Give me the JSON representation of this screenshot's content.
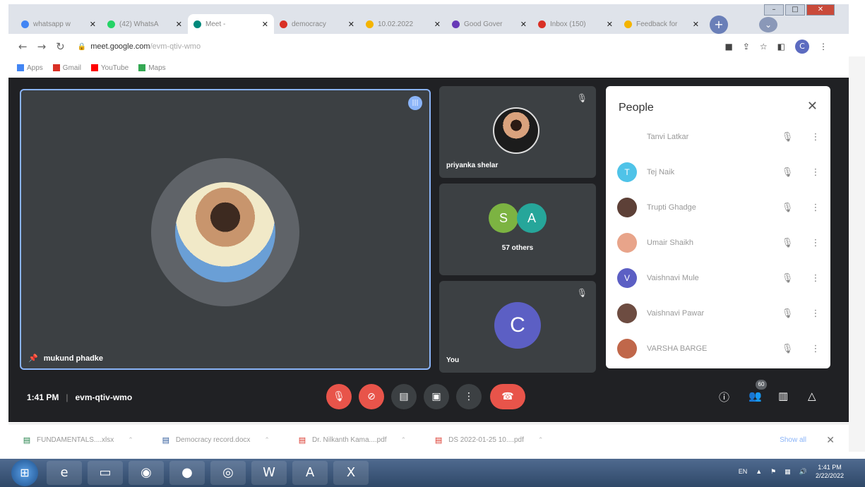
{
  "window": {
    "minimize": "–",
    "maximize": "□",
    "close": "✕"
  },
  "tabs": [
    {
      "label": "whatsapp w",
      "icon": "google-icon",
      "color": "#4285f4",
      "active": false
    },
    {
      "label": "(42) WhatsA",
      "icon": "whatsapp-icon",
      "color": "#25d366",
      "active": false
    },
    {
      "label": "Meet -",
      "icon": "meet-icon",
      "color": "#00897b",
      "active": true
    },
    {
      "label": "democracy",
      "icon": "gmail-icon",
      "color": "#d93025",
      "active": false
    },
    {
      "label": "10.02.2022",
      "icon": "drive-icon",
      "color": "#f4b400",
      "active": false
    },
    {
      "label": "Good Gover",
      "icon": "forms-icon",
      "color": "#673ab7",
      "active": false
    },
    {
      "label": "Inbox (150)",
      "icon": "gmail-icon",
      "color": "#d93025",
      "active": false
    },
    {
      "label": "Feedback for",
      "icon": "drive-icon",
      "color": "#f4b400",
      "active": false
    }
  ],
  "url": {
    "host": "meet.google.com",
    "path": "/evm-qtiv-wmo"
  },
  "profile_initial": "C",
  "bookmarks": [
    {
      "label": "Apps",
      "color": "#4285f4"
    },
    {
      "label": "Gmail",
      "color": "#d93025"
    },
    {
      "label": "YouTube",
      "color": "#ff0000"
    },
    {
      "label": "Maps",
      "color": "#34a853"
    }
  ],
  "main_tile": {
    "name": "mukund phadke"
  },
  "side_tiles": {
    "priyanka": {
      "name": "priyanka shelar"
    },
    "others": {
      "label": "57 others",
      "bubbles": [
        {
          "letter": "S",
          "color": "#7cb342"
        },
        {
          "letter": "A",
          "color": "#26a69a"
        }
      ]
    },
    "you": {
      "name": "You",
      "initial": "C"
    }
  },
  "people_panel": {
    "title": "People",
    "participants": [
      {
        "name": "Tanvi Latkar",
        "initial": "",
        "color": "#ffffff"
      },
      {
        "name": "Tej Naik",
        "initial": "T",
        "color": "#4fc3e8"
      },
      {
        "name": "Trupti Ghadge",
        "initial": "",
        "color": "#5d4037"
      },
      {
        "name": "Umair Shaikh",
        "initial": "",
        "color": "#e8a48a"
      },
      {
        "name": "Vaishnavi Mule",
        "initial": "V",
        "color": "#5c5fc4"
      },
      {
        "name": "Vaishnavi Pawar",
        "initial": "",
        "color": "#6d4c41"
      },
      {
        "name": "VARSHA BARGE",
        "initial": "",
        "color": "#c0674a"
      }
    ]
  },
  "meeting": {
    "time": "1:41 PM",
    "separator": "|",
    "code": "evm-qtiv-wmo",
    "participant_count": "60"
  },
  "downloads": {
    "items": [
      {
        "label": "FUNDAMENTALS....xlsx",
        "icon": "excel-file-icon",
        "color": "#1e7e45"
      },
      {
        "label": "Democracy record.docx",
        "icon": "word-file-icon",
        "color": "#2b579a"
      },
      {
        "label": "Dr. Nilkanth Kama....pdf",
        "icon": "pdf-file-icon",
        "color": "#d93025"
      },
      {
        "label": "DS 2022-01-25 10....pdf",
        "icon": "pdf-file-icon",
        "color": "#d93025"
      }
    ],
    "show_all": "Show all"
  },
  "taskbar": {
    "tray_lang": "EN",
    "clock_time": "1:41 PM",
    "clock_date": "2/22/2022"
  }
}
